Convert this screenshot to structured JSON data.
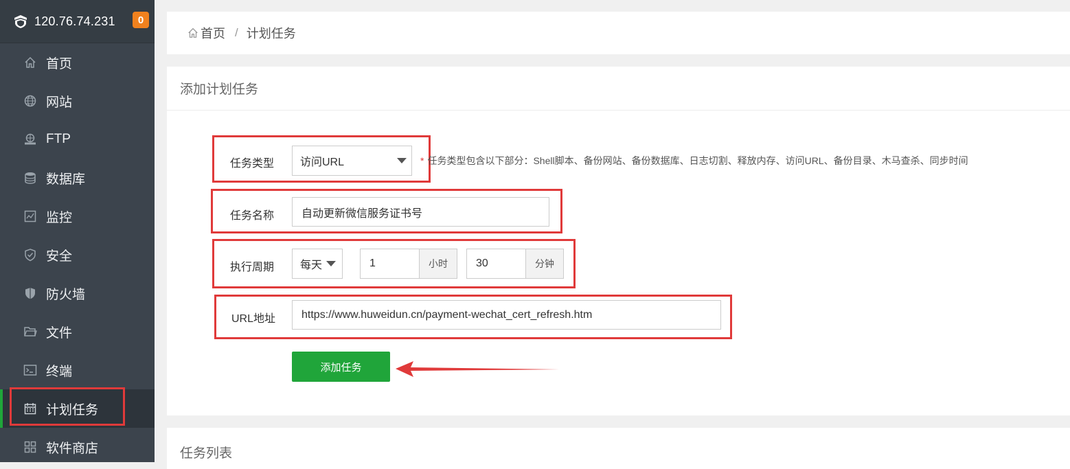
{
  "header": {
    "ip": "120.76.74.231",
    "badge": "0"
  },
  "sidebar": {
    "items": [
      {
        "label": "首页",
        "icon": "home-icon"
      },
      {
        "label": "网站",
        "icon": "globe-icon"
      },
      {
        "label": "FTP",
        "icon": "ftp-icon"
      },
      {
        "label": "数据库",
        "icon": "database-icon"
      },
      {
        "label": "监控",
        "icon": "monitor-icon"
      },
      {
        "label": "安全",
        "icon": "shield-check-icon"
      },
      {
        "label": "防火墙",
        "icon": "firewall-shield-icon"
      },
      {
        "label": "文件",
        "icon": "folder-icon"
      },
      {
        "label": "终端",
        "icon": "terminal-icon"
      },
      {
        "label": "计划任务",
        "icon": "calendar-icon",
        "active": true
      },
      {
        "label": "软件商店",
        "icon": "apps-grid-icon"
      }
    ]
  },
  "breadcrumb": {
    "home": "首页",
    "separator": "/",
    "current": "计划任务"
  },
  "form": {
    "title": "添加计划任务",
    "task_type": {
      "label": "任务类型",
      "value": "访问URL",
      "note_star": "*",
      "note": "任务类型包含以下部分：Shell脚本、备份网站、备份数据库、日志切割、释放内存、访问URL、备份目录、木马查杀、同步时间"
    },
    "task_name": {
      "label": "任务名称",
      "value": "自动更新微信服务证书号"
    },
    "period": {
      "label": "执行周期",
      "freq": "每天",
      "hour": "1",
      "hour_unit": "小时",
      "minute": "30",
      "minute_unit": "分钟"
    },
    "url": {
      "label": "URL地址",
      "value": "https://www.huweidun.cn/payment-wechat_cert_refresh.htm"
    },
    "submit": "添加任务"
  },
  "list": {
    "title": "任务列表"
  },
  "colors": {
    "accent_green": "#20a53a",
    "highlight_red": "#e03a3a",
    "badge_orange": "#f0811e",
    "sidebar_bg": "#3c444d"
  }
}
